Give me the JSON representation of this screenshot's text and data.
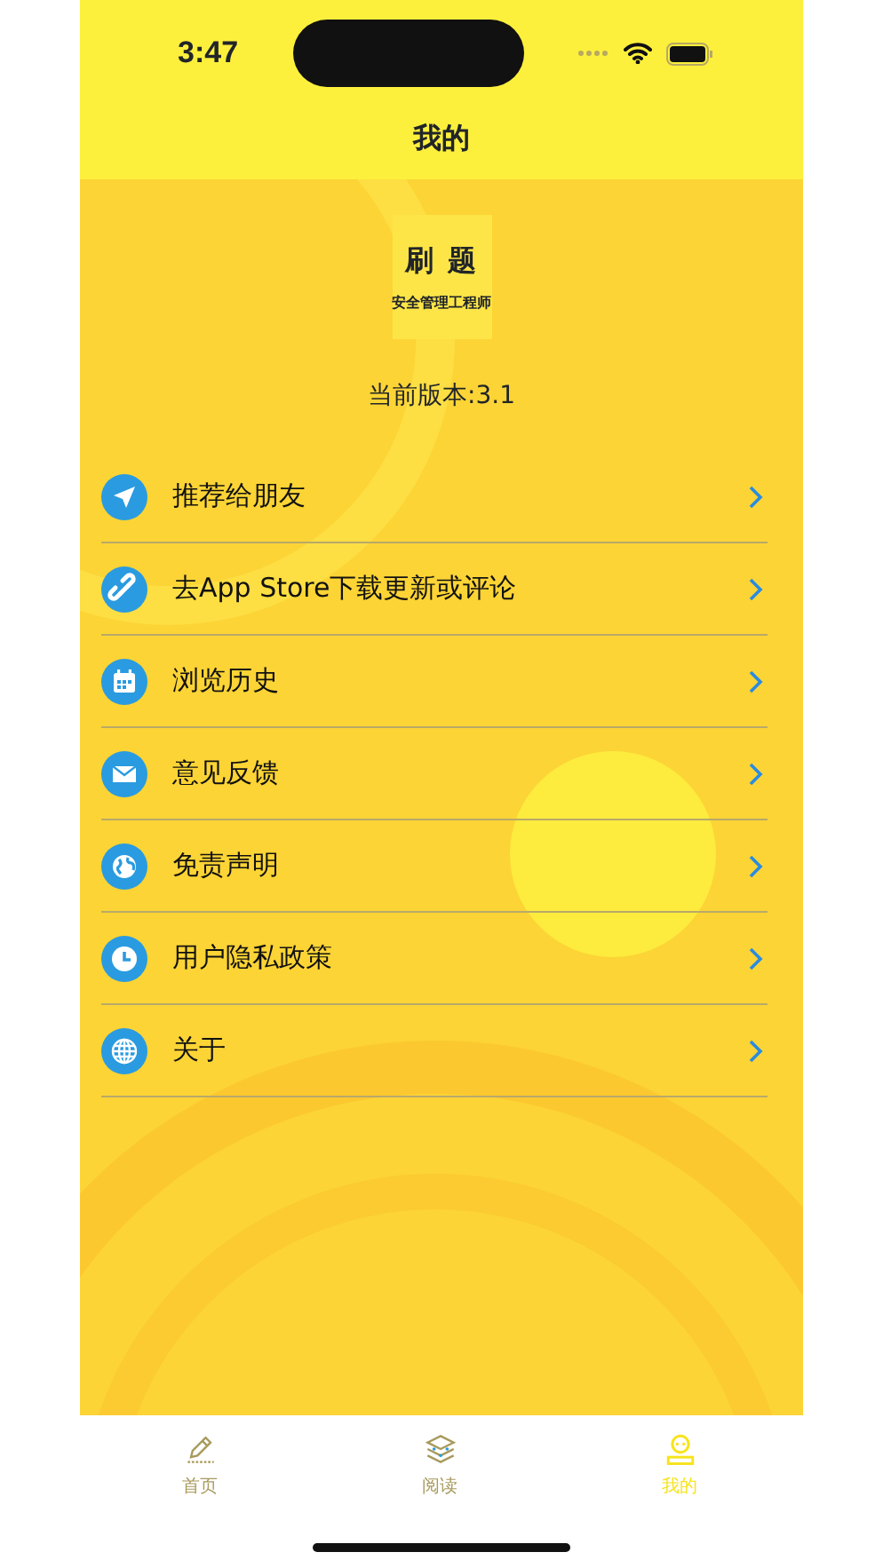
{
  "status_bar": {
    "time": "3:47"
  },
  "title": "我的",
  "app_logo": {
    "title": "刷 题",
    "subtitle": "安全管理工程师"
  },
  "version": "当前版本:3.1",
  "menu": [
    {
      "label": "推荐给朋友"
    },
    {
      "label": "去App Store下载更新或评论"
    },
    {
      "label": "浏览历史"
    },
    {
      "label": "意见反馈"
    },
    {
      "label": "免责声明"
    },
    {
      "label": "用户隐私政策"
    },
    {
      "label": "关于"
    }
  ],
  "tabs": [
    {
      "label": "首页",
      "selected": false
    },
    {
      "label": "阅读",
      "selected": false
    },
    {
      "label": "我的",
      "selected": true
    }
  ]
}
